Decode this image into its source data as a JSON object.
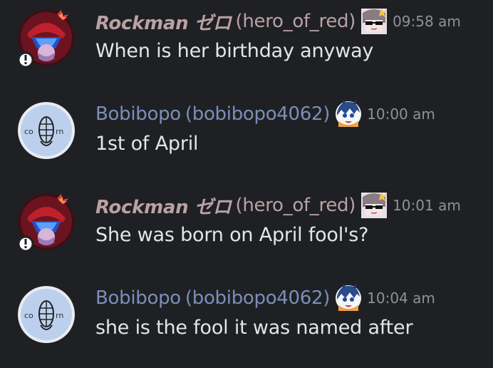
{
  "messages": [
    {
      "author": "Rockman ゼロ",
      "handle": "(hero_of_red)",
      "time": "09:58 am",
      "text": "When is her birthday anyway",
      "avatar_icon": "robot-helmet-avatar-icon",
      "tag_icon": "sunglasses-girl-icon"
    },
    {
      "author": "Bobibopo",
      "handle": "(bobibopo4062)",
      "time": "10:00 am",
      "text": "1st of April",
      "avatar_icon": "corn-logo-avatar-icon",
      "tag_icon": "blue-hair-girl-icon"
    },
    {
      "author": "Rockman ゼロ",
      "handle": "(hero_of_red)",
      "time": "10:01 am",
      "text": "She was born on April fool's?",
      "avatar_icon": "robot-helmet-avatar-icon",
      "tag_icon": "sunglasses-girl-icon"
    },
    {
      "author": "Bobibopo",
      "handle": "(bobibopo4062)",
      "time": "10:04 am",
      "text": "she is the fool it was named after",
      "avatar_icon": "corn-logo-avatar-icon",
      "tag_icon": "blue-hair-girl-icon"
    }
  ],
  "corn_avatar_text": "co rn",
  "colors": {
    "background": "#1f2023",
    "rockman_name": "#b9a1a4",
    "bobibopo_name": "#7a8fb8",
    "timestamp": "#8e9297",
    "message_text": "#e3e5e8"
  }
}
